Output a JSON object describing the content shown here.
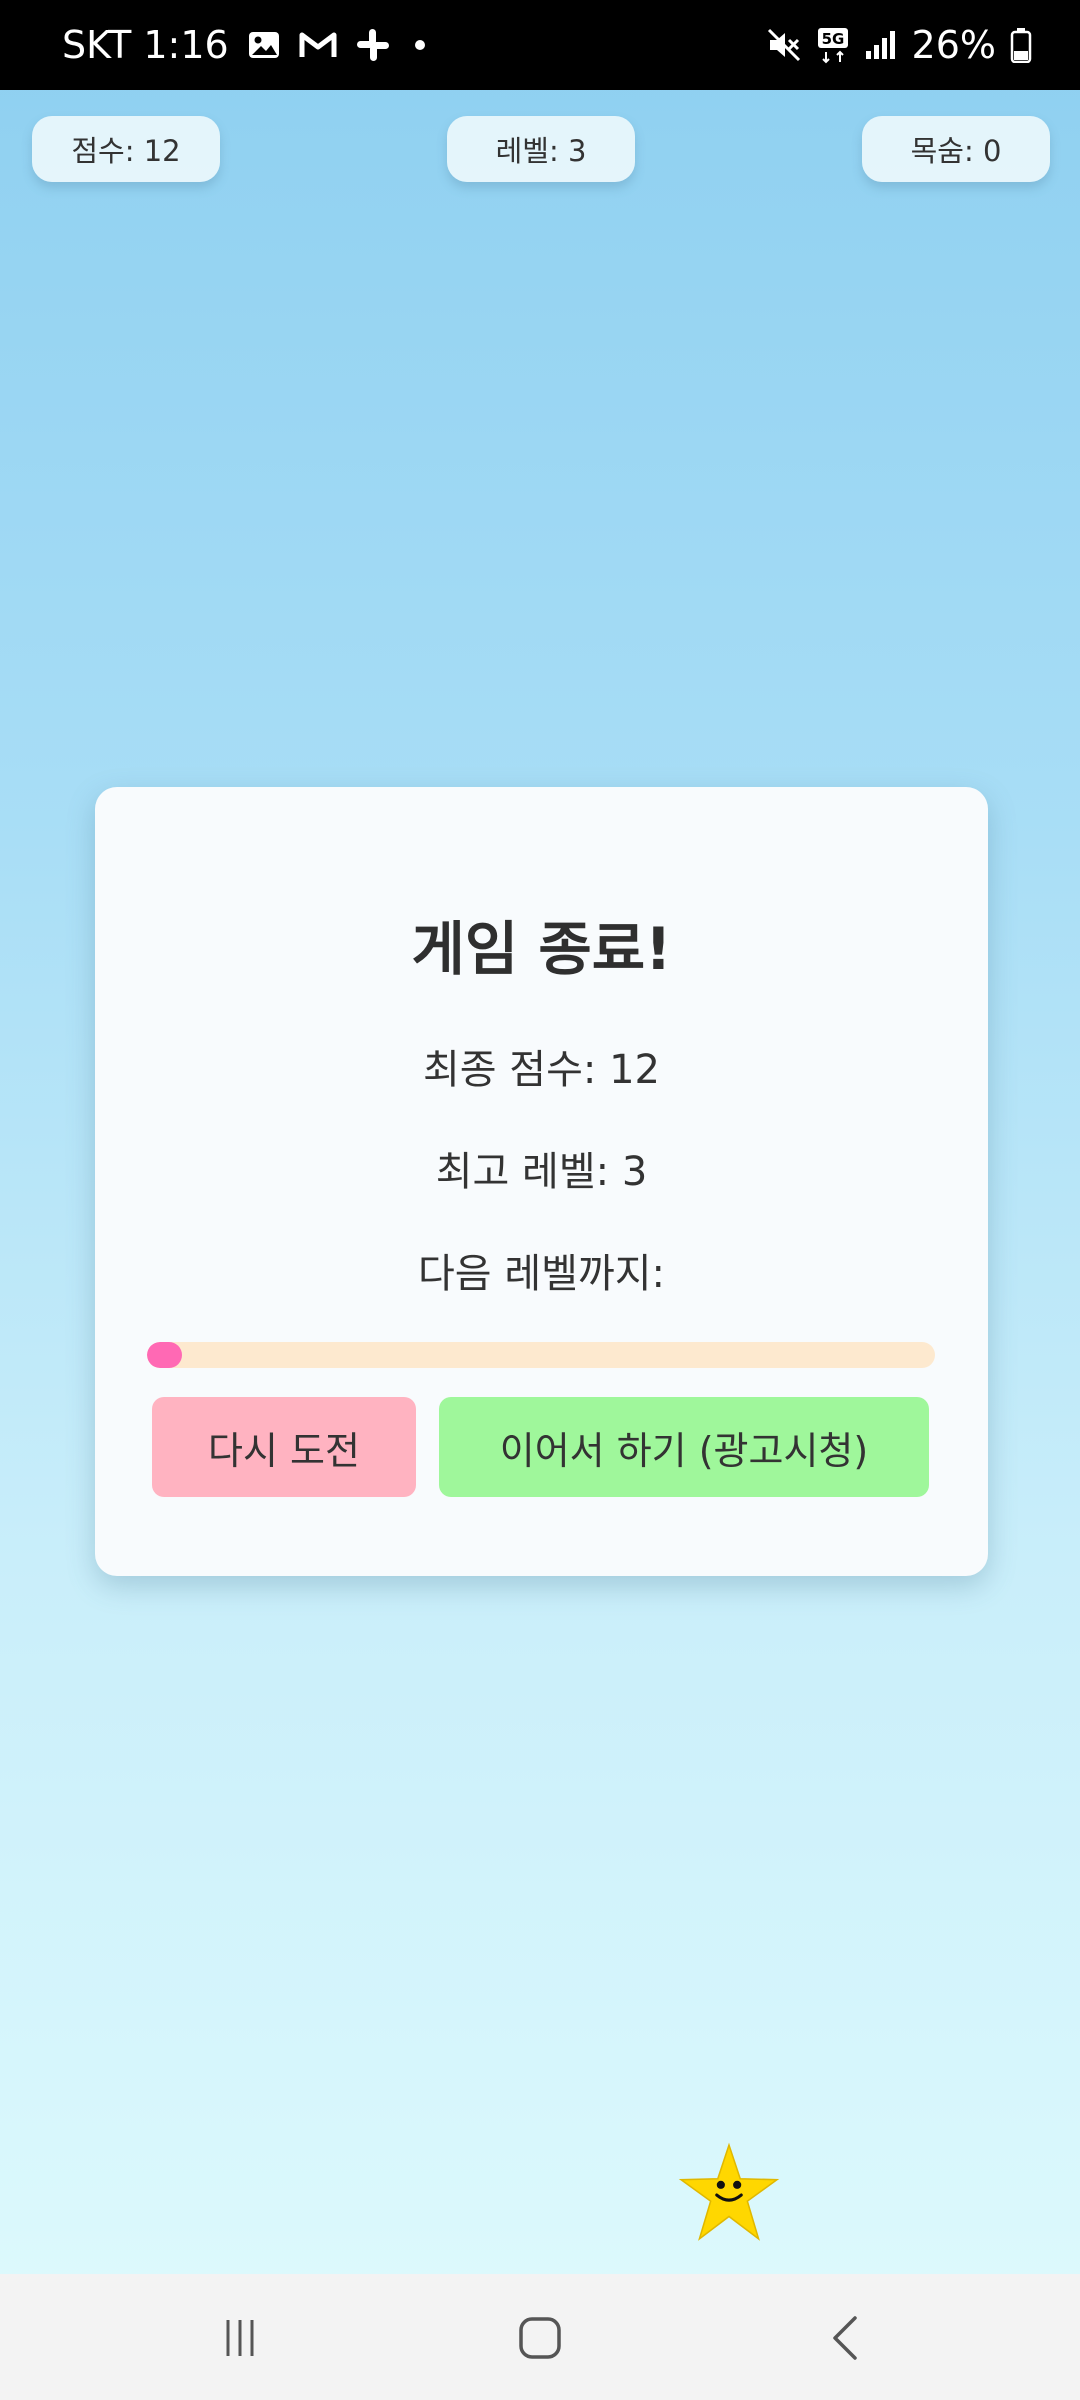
{
  "status_bar": {
    "carrier_time": "SKT 1:16",
    "battery": "26%",
    "icons": [
      "gallery-icon",
      "gmail-icon",
      "slack-icon",
      "notification-dot",
      "mute-icon",
      "5g-icon",
      "signal-icon",
      "battery-icon"
    ]
  },
  "hud": {
    "score": "점수: 12",
    "level": "레벨: 3",
    "lives": "목숨: 0"
  },
  "modal": {
    "title": "게임 종료!",
    "final_score": "최종 점수: 12",
    "best_level": "최고 레벨: 3",
    "next_level_label": "다음 레벨까지:",
    "progress_fraction": 0.045,
    "retry_label": "다시 도전",
    "continue_label": "이어서 하기 (광고시청)"
  },
  "colors": {
    "progress_fill": "#ff69b4",
    "progress_track": "#fde9cf",
    "retry_button": "#ffb3c1",
    "continue_button": "#9ff79b",
    "star": "#ffd700"
  },
  "nav": {
    "icons": [
      "recents-icon",
      "home-icon",
      "back-icon"
    ]
  }
}
